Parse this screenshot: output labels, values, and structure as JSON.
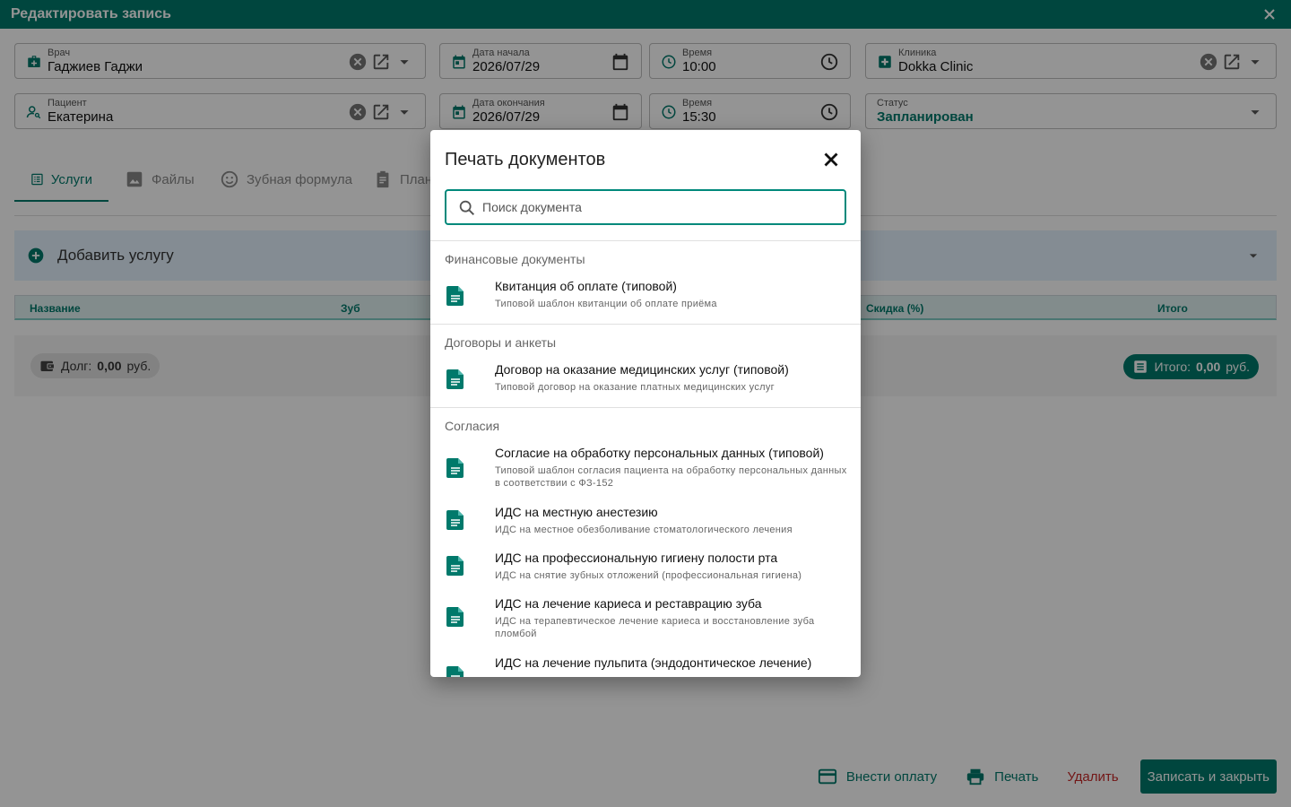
{
  "window": {
    "title": "Редактировать запись"
  },
  "fields": {
    "doctor": {
      "label": "Врач",
      "value": "Гаджиев Гаджи"
    },
    "start_date": {
      "label": "Дата начала",
      "value": "2026/07/29"
    },
    "start_time": {
      "label": "Время",
      "value": "10:00"
    },
    "clinic": {
      "label": "Клиника",
      "value": "Dokka Clinic"
    },
    "patient": {
      "label": "Пациент",
      "value": "Екатерина"
    },
    "end_date": {
      "label": "Дата окончания",
      "value": "2026/07/29"
    },
    "end_time": {
      "label": "Время",
      "value": "15:30"
    },
    "status": {
      "label": "Статус",
      "value": "Запланирован"
    }
  },
  "tabs": [
    {
      "label": "Услуги",
      "icon": "list-icon",
      "active": true
    },
    {
      "label": "Файлы",
      "icon": "image-icon"
    },
    {
      "label": "Зубная формула",
      "icon": "smile-icon"
    },
    {
      "label": "Планы",
      "icon": "clipboard-icon"
    }
  ],
  "services": {
    "add_label": "Добавить услугу",
    "columns": {
      "name": "Название",
      "tooth": "Зуб",
      "discount": "Скидка (%)",
      "total": "Итого"
    }
  },
  "summary": {
    "debt_label": "Долг:",
    "debt_value": "0,00",
    "debt_currency": "руб.",
    "total_label": "Итого:",
    "total_value": "0,00",
    "total_currency": "руб."
  },
  "actions": {
    "pay": "Внести оплату",
    "print": "Печать",
    "delete": "Удалить",
    "save_close": "Записать и закрыть"
  },
  "dialog": {
    "title": "Печать документов",
    "search_placeholder": "Поиск документа",
    "groups": [
      {
        "title": "Финансовые документы",
        "documents": [
          {
            "name": "Квитанция об оплате (типовой)",
            "description": "Типовой шаблон квитанции об оплате приёма"
          }
        ]
      },
      {
        "title": "Договоры и анкеты",
        "documents": [
          {
            "name": "Договор на оказание медицинских услуг (типовой)",
            "description": "Типовой договор на оказание платных медицинских услуг"
          }
        ]
      },
      {
        "title": "Согласия",
        "documents": [
          {
            "name": "Согласие на обработку персональных данных (типовой)",
            "description": "Типовой шаблон согласия пациента на обработку персональных данных в соответствии с ФЗ-152"
          },
          {
            "name": "ИДС на местную анестезию",
            "description": "ИДС на местное обезболивание стоматологического лечения"
          },
          {
            "name": "ИДС на профессиональную гигиену полости рта",
            "description": "ИДС на снятие зубных отложений (профессиональная гигиена)"
          },
          {
            "name": "ИДС на лечение кариеса и реставрацию зуба",
            "description": "ИДС на терапевтическое лечение кариеса и восстановление зуба пломбой"
          },
          {
            "name": "ИДС на лечение пульпита (эндодонтическое лечение)",
            "description": ""
          }
        ]
      }
    ]
  }
}
